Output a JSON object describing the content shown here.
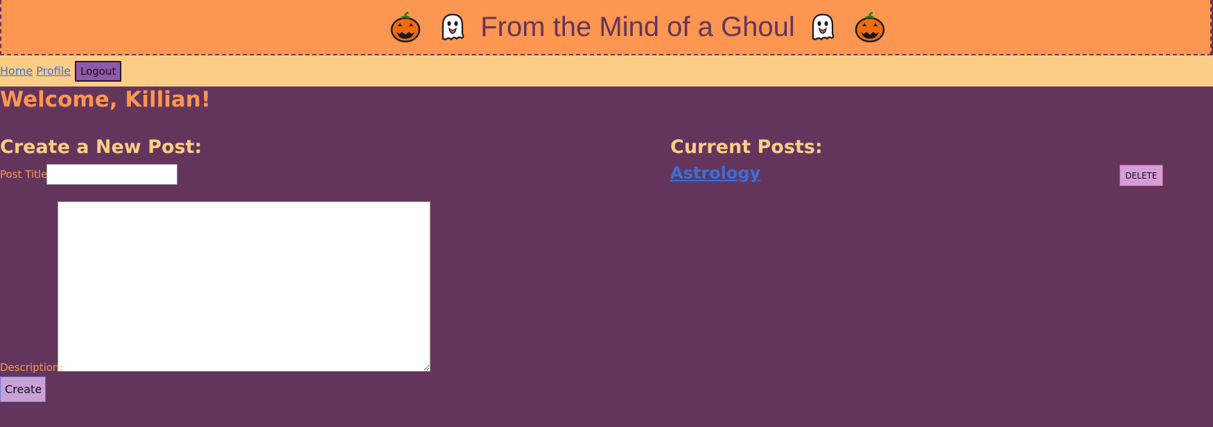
{
  "header": {
    "title": "From the Mind of a Ghoul",
    "left_icons": [
      "jack-o-lantern-icon",
      "ghost-icon"
    ],
    "right_icons": [
      "ghost-icon",
      "jack-o-lantern-icon"
    ]
  },
  "nav": {
    "home": "Home",
    "profile": "Profile",
    "logout": "Logout"
  },
  "welcome": "Welcome, Killian!",
  "create_post": {
    "heading": "Create a New Post:",
    "title_label": "Post Title:",
    "title_value": "",
    "description_label": "Description:",
    "description_value": "",
    "create_button": "Create"
  },
  "current_posts": {
    "heading": "Current Posts:",
    "items": [
      {
        "title": "Astrology",
        "delete_label": "DELETE"
      }
    ]
  },
  "colors": {
    "background": "#63355c",
    "header": "#fc9651",
    "navbar": "#fdcd85",
    "accent_orange": "#fc9651",
    "heading": "#fdcd85",
    "link": "#3a6fd8"
  }
}
